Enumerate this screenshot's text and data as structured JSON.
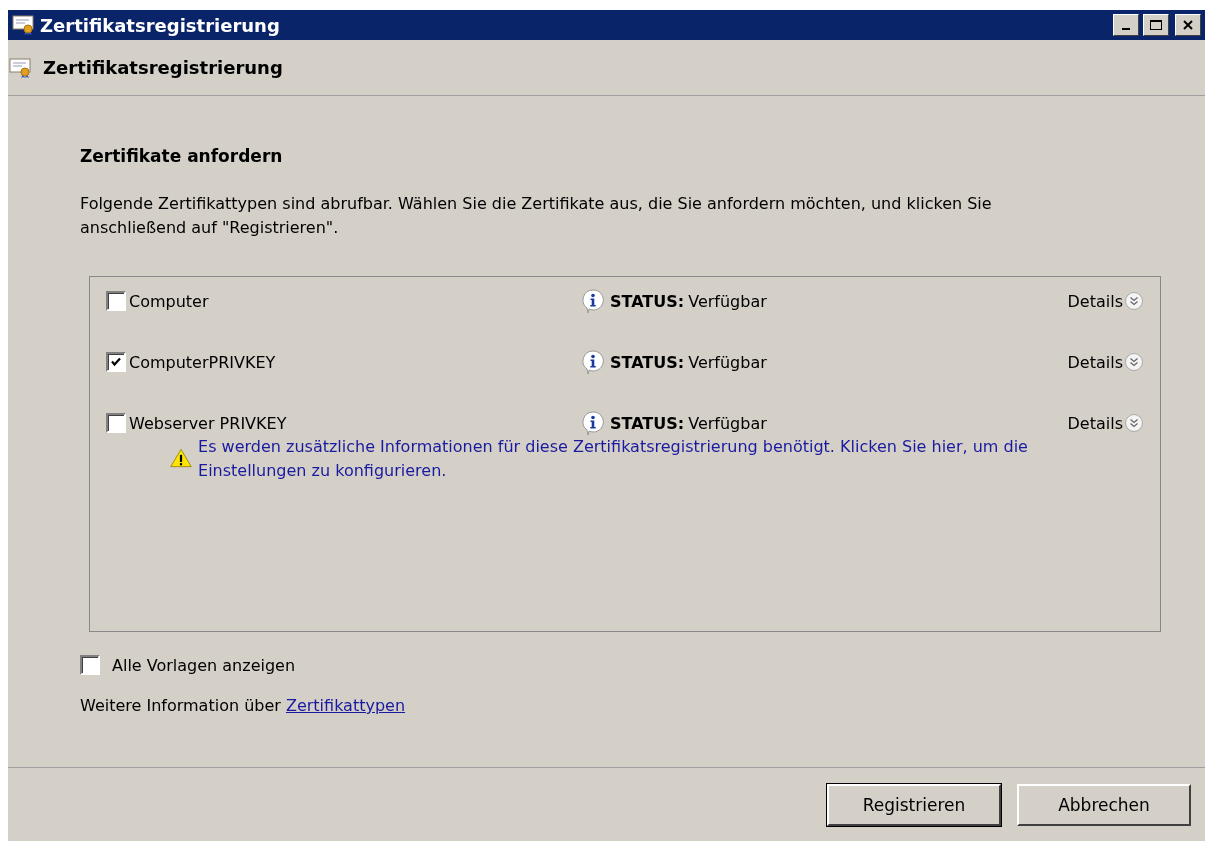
{
  "window": {
    "title": "Zertifikatsregistrierung"
  },
  "header": {
    "title": "Zertifikatsregistrierung"
  },
  "section": {
    "heading": "Zertifikate anfordern",
    "description": "Folgende Zertifikattypen sind abrufbar. Wählen Sie die Zertifikate aus, die Sie anfordern möchten, und klicken Sie anschließend auf \"Registrieren\"."
  },
  "certificates": [
    {
      "name": "Computer",
      "checked": false,
      "status_label": "STATUS:",
      "status_value": "Verfügbar",
      "details": "Details"
    },
    {
      "name": "ComputerPRIVKEY",
      "checked": true,
      "status_label": "STATUS:",
      "status_value": "Verfügbar",
      "details": "Details"
    },
    {
      "name": "Webserver PRIVKEY",
      "checked": false,
      "status_label": "STATUS:",
      "status_value": "Verfügbar",
      "details": "Details",
      "warning": "Es werden zusätzliche Informationen für diese Zertifikatsregistrierung benötigt. Klicken Sie hier, um die Einstellungen zu konfigurieren."
    }
  ],
  "show_all": {
    "label": "Alle Vorlagen anzeigen",
    "checked": false
  },
  "more_info": {
    "text": "Weitere Information über",
    "link": "Zertifikattypen"
  },
  "buttons": [
    {
      "label": "Registrieren",
      "default": true
    },
    {
      "label": "Abbrechen",
      "default": false
    }
  ]
}
